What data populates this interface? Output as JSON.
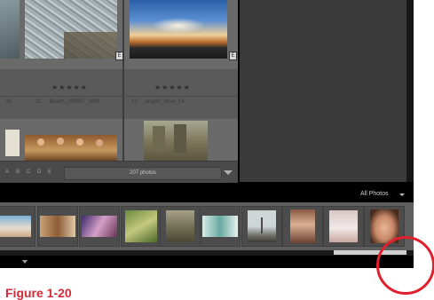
{
  "grid": {
    "top_row": [
      {
        "badge": "E"
      },
      {
        "badge": "E"
      }
    ],
    "meta_row": [
      {
        "prefix": "26"
      },
      {
        "number": "11",
        "filename": "Beach_20090T_3261"
      },
      {
        "number": "12",
        "filename": "angels_drive_14"
      }
    ],
    "ratings": [
      "★★★★★",
      "★★★★★"
    ]
  },
  "toolbar": {
    "icons": [
      "A",
      "B",
      "C",
      "D",
      "E"
    ],
    "photo_count": "207 photos"
  },
  "filmstrip": {
    "filter_label": "All Photos"
  },
  "figure": {
    "caption": "Figure 1-20"
  },
  "colors": {
    "accent_red": "#d12a38",
    "panel_dark": "#3a3a3a",
    "grid_bg": "#5a5a5a"
  }
}
